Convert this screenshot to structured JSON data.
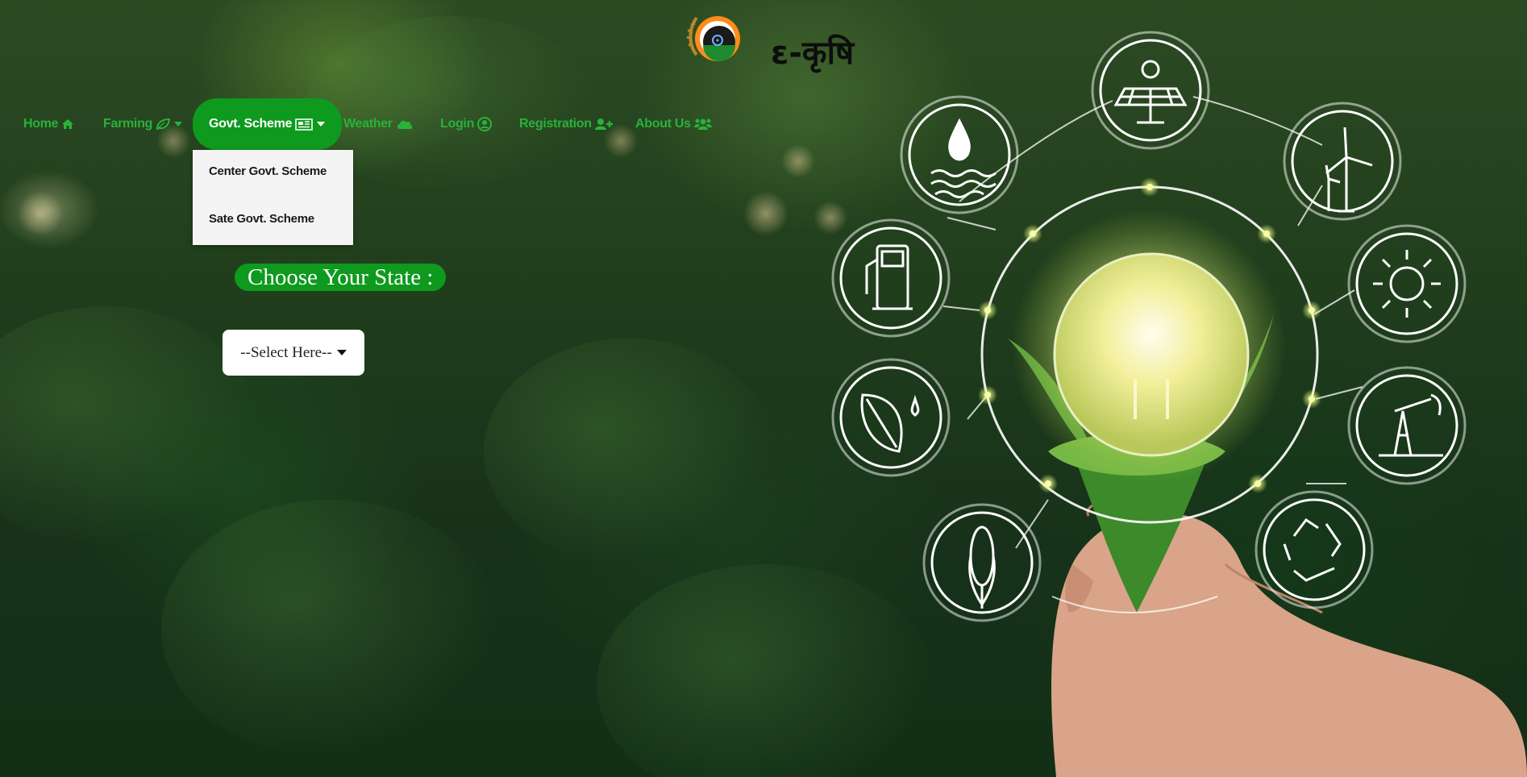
{
  "brand": {
    "title": "ε-कृषि",
    "logo_icon": "ashoka-chakra-wheat-emblem"
  },
  "nav": {
    "items": [
      {
        "label": "Home",
        "icon": "home-icon"
      },
      {
        "label": "Farming",
        "icon": "leaf-icon",
        "has_caret": true
      },
      {
        "label": "Govt. Scheme",
        "icon": "newspaper-icon",
        "has_caret": true,
        "active": true
      },
      {
        "label": "Weather",
        "icon": "cloud-icon"
      },
      {
        "label": "Login",
        "icon": "user-circle-icon"
      },
      {
        "label": "Registration",
        "icon": "user-plus-icon"
      },
      {
        "label": "About Us",
        "icon": "users-icon"
      }
    ]
  },
  "dropdown": {
    "items": [
      "Center Govt. Scheme",
      "Sate Govt. Scheme"
    ]
  },
  "state_picker": {
    "label": "Choose Your State :",
    "selected": "--Select Here--"
  },
  "colors": {
    "accent_green": "#0e9a1e",
    "nav_text_green": "#29b23a",
    "dropdown_bg": "#f3f4f3"
  },
  "illustration": {
    "icons": [
      "solar-panel-icon",
      "wind-turbine-icon",
      "sun-icon",
      "oil-pump-icon",
      "recycle-icon",
      "corn-icon",
      "leaf-drop-icon",
      "fuel-pump-icon",
      "water-drop-icon",
      "lightbulb-plant-icon"
    ]
  }
}
